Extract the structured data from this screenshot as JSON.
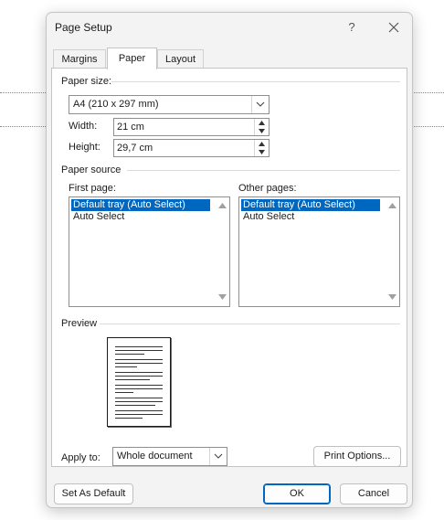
{
  "dialog": {
    "title": "Page Setup",
    "help_glyph": "?"
  },
  "tabs": [
    {
      "label": "Margins",
      "active": false
    },
    {
      "label": "Paper",
      "active": true
    },
    {
      "label": "Layout",
      "active": false
    }
  ],
  "paper_size": {
    "section_label": "Paper size:",
    "selected": "A4 (210 x 297 mm)",
    "width_label": "Width:",
    "width_value": "21 cm",
    "height_label": "Height:",
    "height_value": "29,7 cm"
  },
  "paper_source": {
    "section_label": "Paper source",
    "first_page": {
      "label": "First page:",
      "items": [
        "Default tray (Auto Select)",
        "Auto Select"
      ],
      "selected_index": 0
    },
    "other_pages": {
      "label": "Other pages:",
      "items": [
        "Default tray (Auto Select)",
        "Auto Select"
      ],
      "selected_index": 0
    }
  },
  "preview": {
    "section_label": "Preview"
  },
  "apply_to": {
    "label": "Apply to:",
    "selected": "Whole document"
  },
  "buttons": {
    "print_options": "Print Options...",
    "set_as_default": "Set As Default",
    "ok": "OK",
    "cancel": "Cancel"
  },
  "colors": {
    "selection": "#0067c0",
    "dialog_bg": "#f3f3f3",
    "panel_bg": "#ffffff"
  },
  "icons": {
    "close": "close-icon",
    "dropdown": "chevron-down-icon",
    "spin_up": "spin-up-icon",
    "spin_down": "spin-down-icon",
    "scroll_up": "scroll-up-arrow-icon",
    "scroll_down": "scroll-down-arrow-icon"
  }
}
